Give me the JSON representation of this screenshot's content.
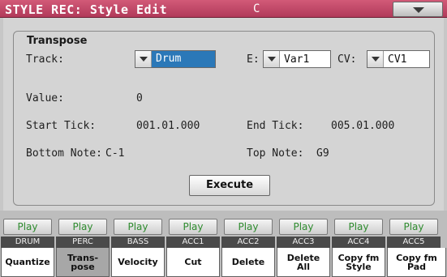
{
  "header": {
    "title": "STYLE REC: Style Edit",
    "key": "C"
  },
  "group": {
    "title": "Transpose"
  },
  "track": {
    "label": "Track:",
    "value": "Drum"
  },
  "element": {
    "label": "E:",
    "value": "Var1"
  },
  "chord_variation": {
    "label": "CV:",
    "value": "CV1"
  },
  "value_field": {
    "label": "Value:",
    "value": "0"
  },
  "start_tick": {
    "label": "Start Tick:",
    "value": "001.01.000"
  },
  "end_tick": {
    "label": "End Tick:",
    "value": "005.01.000"
  },
  "bottom_note": {
    "label": "Bottom Note:",
    "value": "C-1"
  },
  "top_note": {
    "label": "Top Note:",
    "value": "G9"
  },
  "execute_label": "Execute",
  "tracks": [
    {
      "play": "Play",
      "name": "DRUM"
    },
    {
      "play": "Play",
      "name": "PERC"
    },
    {
      "play": "Play",
      "name": "BASS"
    },
    {
      "play": "Play",
      "name": "ACC1"
    },
    {
      "play": "Play",
      "name": "ACC2"
    },
    {
      "play": "Play",
      "name": "ACC3"
    },
    {
      "play": "Play",
      "name": "ACC4"
    },
    {
      "play": "Play",
      "name": "ACC5"
    }
  ],
  "tabs": [
    {
      "label": "Quantize",
      "active": false
    },
    {
      "label": "Trans-\npose",
      "active": true
    },
    {
      "label": "Velocity",
      "active": false
    },
    {
      "label": "Cut",
      "active": false
    },
    {
      "label": "Delete",
      "active": false
    },
    {
      "label": "Delete\nAll",
      "active": false
    },
    {
      "label": "Copy fm\nStyle",
      "active": false
    },
    {
      "label": "Copy fm\nPad",
      "active": false
    }
  ],
  "colors": {
    "header": "#c04868",
    "selection": "#2b78b8",
    "play_text": "#2e8b2e"
  }
}
